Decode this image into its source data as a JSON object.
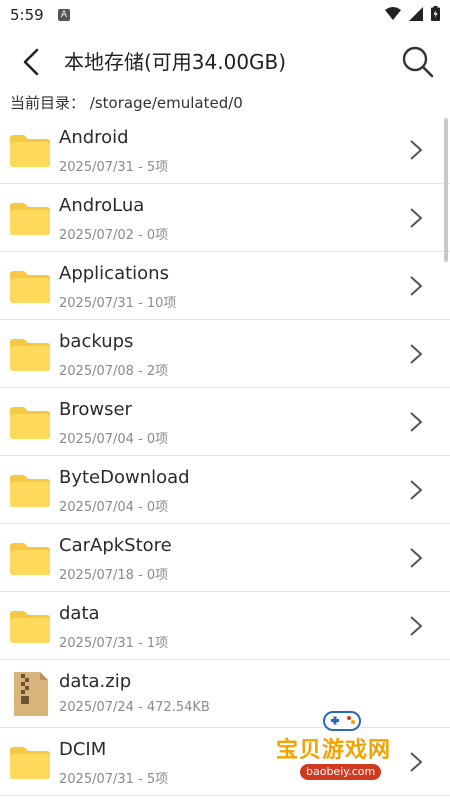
{
  "status": {
    "time": "5:59",
    "notif_letter": "A"
  },
  "appbar": {
    "title": "本地存储(可用34.00GB)"
  },
  "path": {
    "label": "当前目录：",
    "value": "/storage/emulated/0"
  },
  "files": [
    {
      "name": "Android",
      "meta": "2025/07/31 - 5项",
      "type": "folder"
    },
    {
      "name": "AndroLua",
      "meta": "2025/07/02 - 0项",
      "type": "folder"
    },
    {
      "name": "Applications",
      "meta": "2025/07/31 - 10项",
      "type": "folder"
    },
    {
      "name": "backups",
      "meta": "2025/07/08 - 2项",
      "type": "folder"
    },
    {
      "name": "Browser",
      "meta": "2025/07/04 - 0项",
      "type": "folder"
    },
    {
      "name": "ByteDownload",
      "meta": "2025/07/04 - 0项",
      "type": "folder"
    },
    {
      "name": "CarApkStore",
      "meta": "2025/07/18 - 0项",
      "type": "folder"
    },
    {
      "name": "data",
      "meta": "2025/07/31 - 1项",
      "type": "folder"
    },
    {
      "name": "data.zip",
      "meta": "2025/07/24 - 472.54KB",
      "type": "zip"
    },
    {
      "name": "DCIM",
      "meta": "2025/07/31 - 5项",
      "type": "folder"
    }
  ],
  "watermark": {
    "title": "宝贝游戏网",
    "site": "baobeiy.com"
  },
  "colors": {
    "folder": "#FFD95C",
    "folder_tab": "#F6C945",
    "zip": "#D8B47A",
    "divider": "#E3E3E3"
  }
}
